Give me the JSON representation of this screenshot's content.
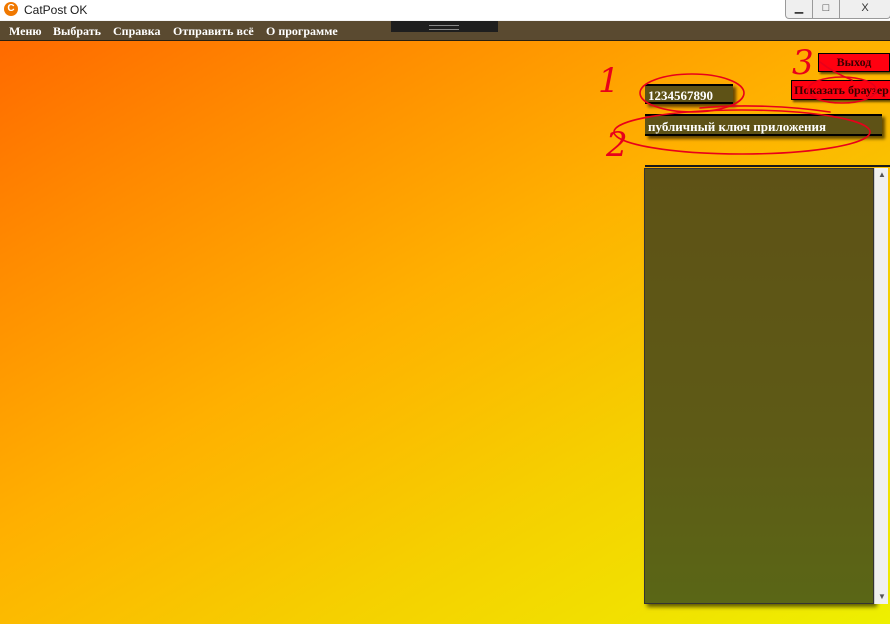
{
  "window": {
    "title": "CatPost OK",
    "app_icon": "catpost-icon",
    "controls": {
      "minimize": "▁",
      "maximize": "□",
      "close": "X"
    }
  },
  "menubar": {
    "items": [
      {
        "label": "Меню"
      },
      {
        "label": "Выбрать"
      },
      {
        "label": "Справка"
      },
      {
        "label": "Отправить всё"
      },
      {
        "label": "О программе"
      }
    ]
  },
  "panel": {
    "app_id": "1234567890",
    "public_key": "публичный ключ приложения",
    "exit_button": "Выход",
    "show_browser_button": "Показать браузер",
    "log_text": ""
  },
  "annotations": {
    "numbers": [
      "1",
      "2",
      "3"
    ],
    "color": "#e8001a"
  },
  "colors": {
    "gradient_start": "#ff6a00",
    "gradient_end": "#eef000",
    "field_bg": "#5e5216",
    "button_red": "#ff0010"
  }
}
